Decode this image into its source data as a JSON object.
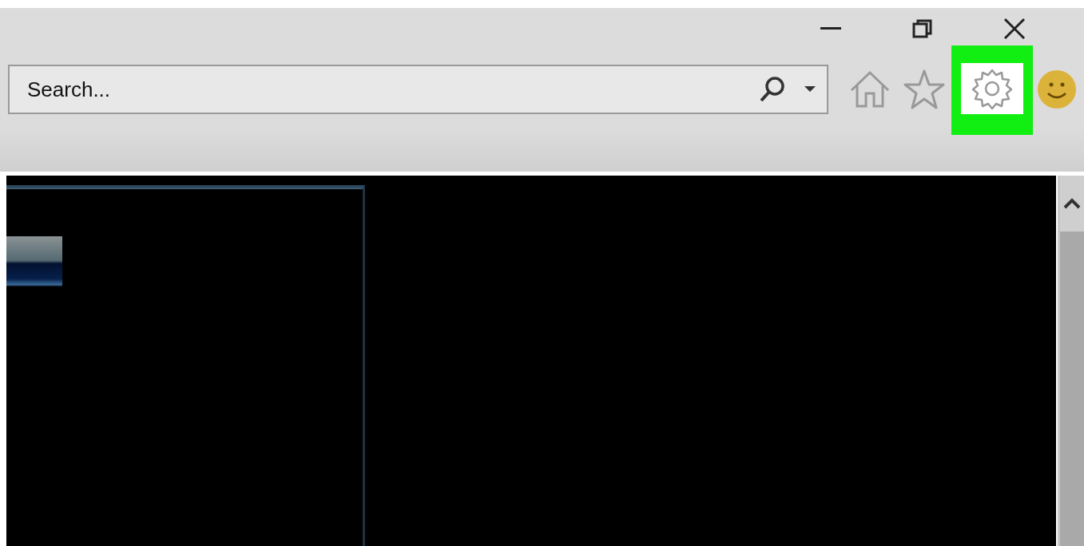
{
  "window_controls": [
    {
      "kind": "minimize"
    },
    {
      "kind": "restore"
    },
    {
      "kind": "close"
    }
  ],
  "search": {
    "placeholder": "Search..."
  },
  "toolbar_buttons": [
    {
      "kind": "home",
      "highlighted": false
    },
    {
      "kind": "favorites",
      "highlighted": false
    },
    {
      "kind": "settings",
      "highlighted": true
    },
    {
      "kind": "feedback",
      "highlighted": false
    }
  ]
}
